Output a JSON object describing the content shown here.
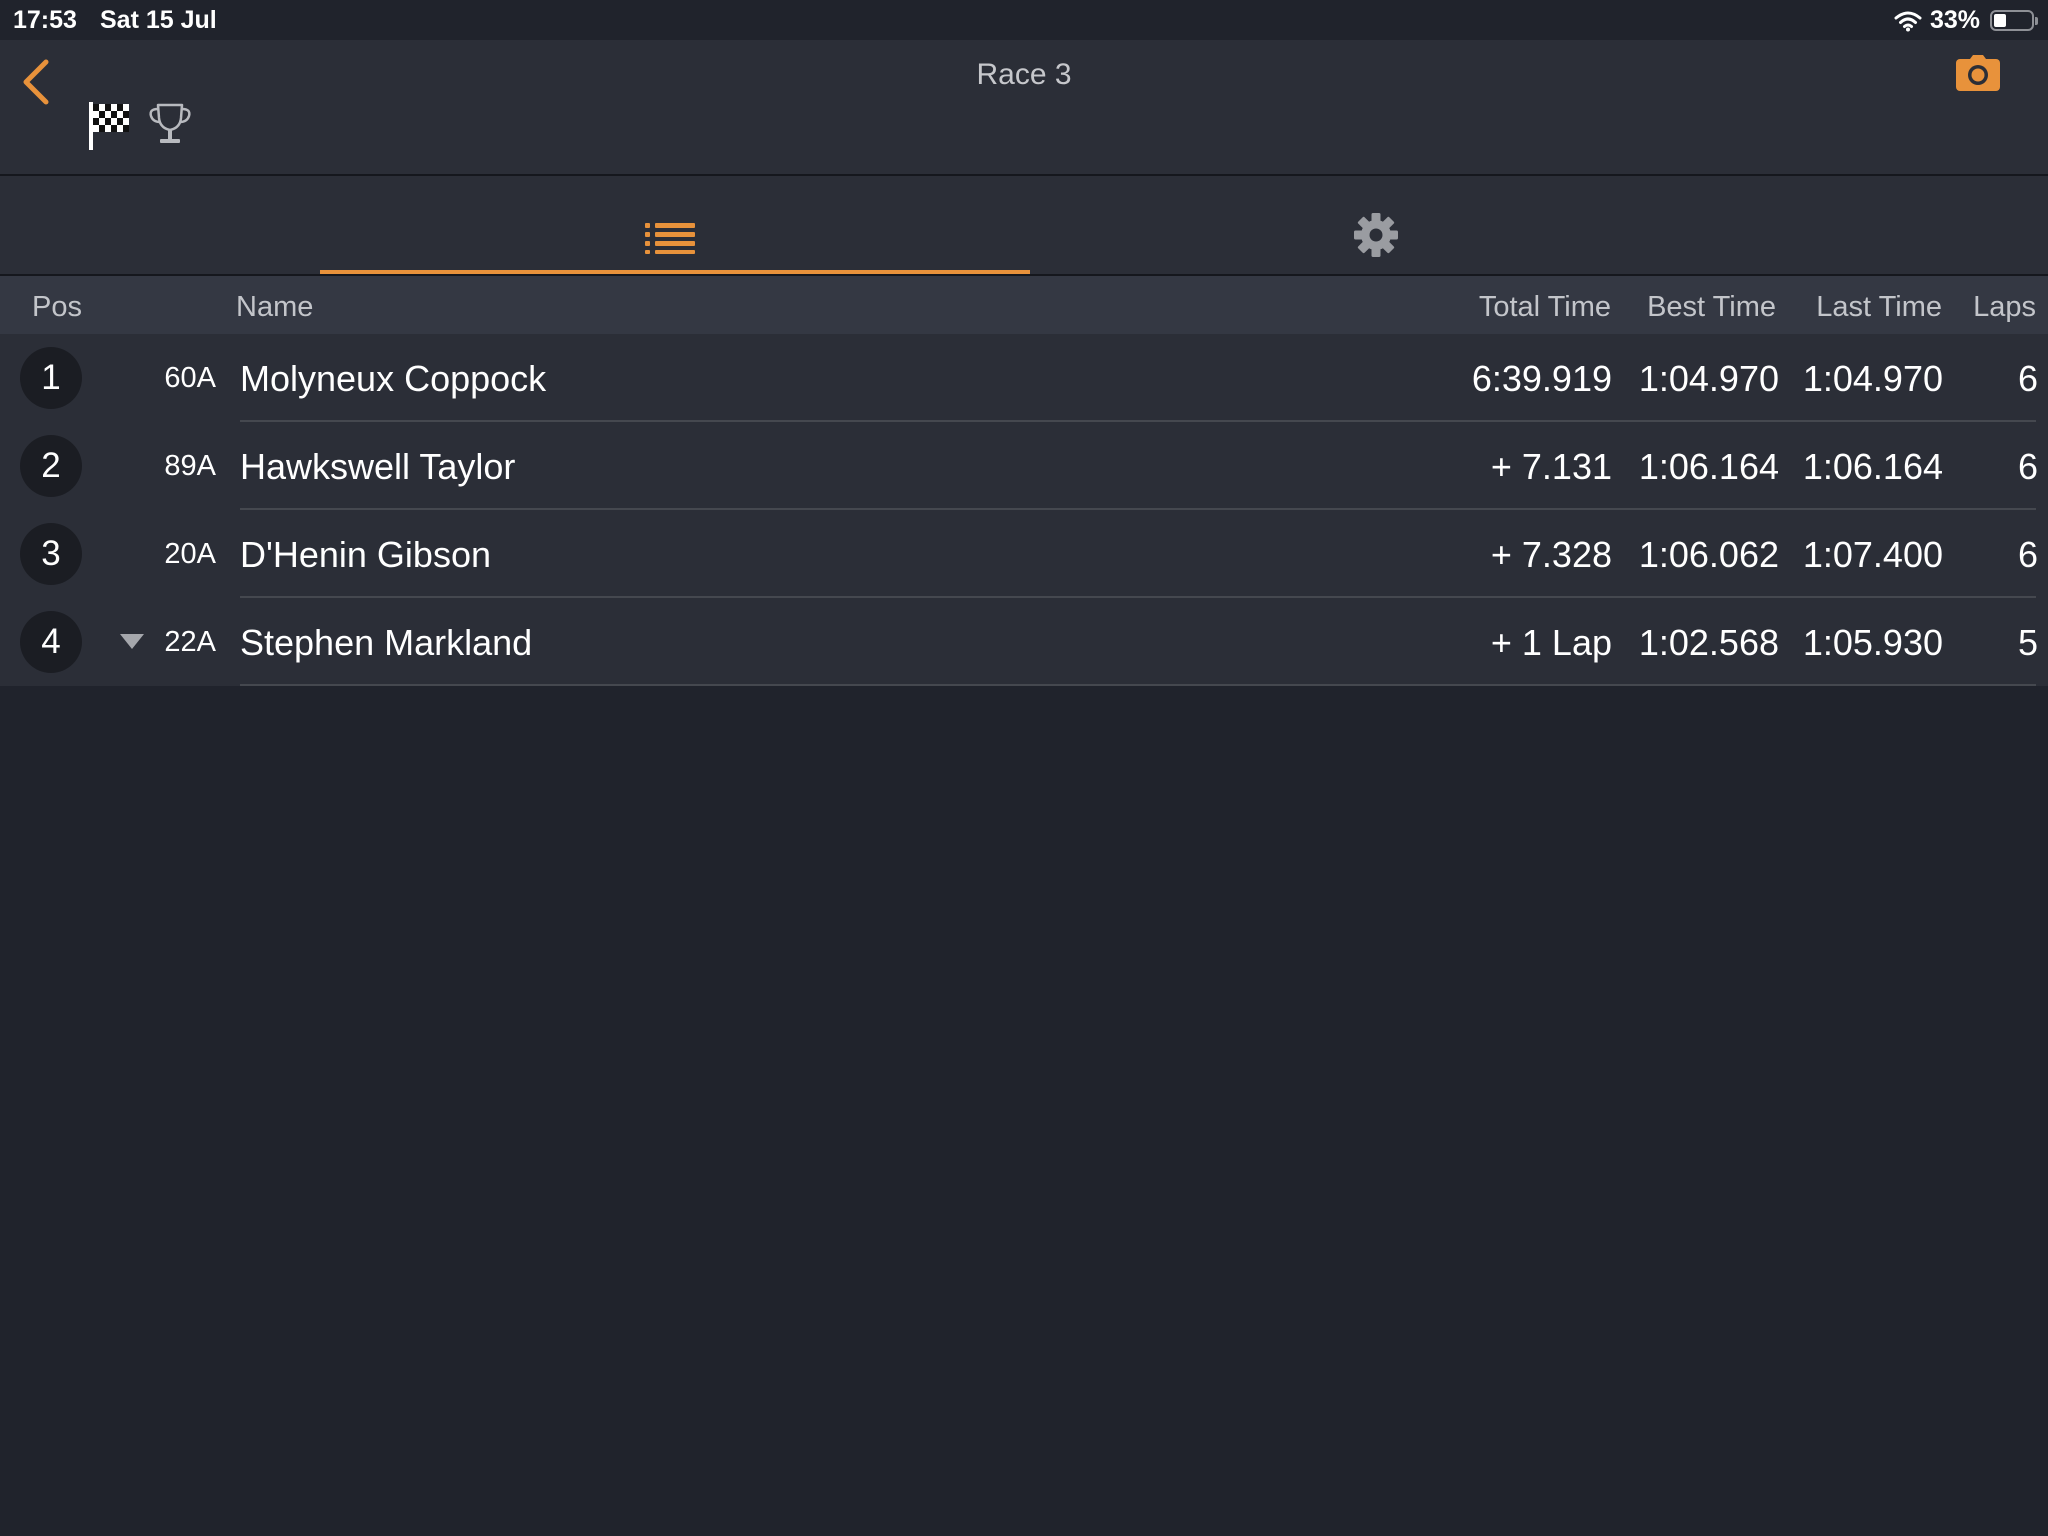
{
  "status_bar": {
    "time": "17:53",
    "date": "Sat 15 Jul",
    "battery_percent": "33%",
    "battery_level": 0.33,
    "icons": [
      "wifi-icon",
      "battery-icon"
    ]
  },
  "header": {
    "title": "Race 3",
    "icons": [
      "back-chevron-icon",
      "checkered-flag-icon",
      "trophy-icon",
      "camera-icon"
    ]
  },
  "tabs": [
    {
      "icon": "list-icon",
      "active": true
    },
    {
      "icon": "gear-icon",
      "active": false
    }
  ],
  "colors": {
    "accent": "#e8923b",
    "background": "#20232c",
    "panel": "#2b2e37",
    "header_row": "#343843"
  },
  "table": {
    "columns": {
      "pos": "Pos",
      "name": "Name",
      "total_time": "Total Time",
      "best_time": "Best Time",
      "last_time": "Last Time",
      "laps": "Laps"
    },
    "rows": [
      {
        "pos": "1",
        "car": "60A",
        "name": "Molyneux Coppock",
        "total": "6:39.919",
        "best": "1:04.970",
        "last": "1:04.970",
        "laps": "6",
        "trend": ""
      },
      {
        "pos": "2",
        "car": "89A",
        "name": "Hawkswell Taylor",
        "total": "+ 7.131",
        "best": "1:06.164",
        "last": "1:06.164",
        "laps": "6",
        "trend": ""
      },
      {
        "pos": "3",
        "car": "20A",
        "name": "D'Henin Gibson",
        "total": "+ 7.328",
        "best": "1:06.062",
        "last": "1:07.400",
        "laps": "6",
        "trend": ""
      },
      {
        "pos": "4",
        "car": "22A",
        "name": "Stephen Markland",
        "total": "+ 1 Lap",
        "best": "1:02.568",
        "last": "1:05.930",
        "laps": "5",
        "trend": "down"
      }
    ]
  }
}
